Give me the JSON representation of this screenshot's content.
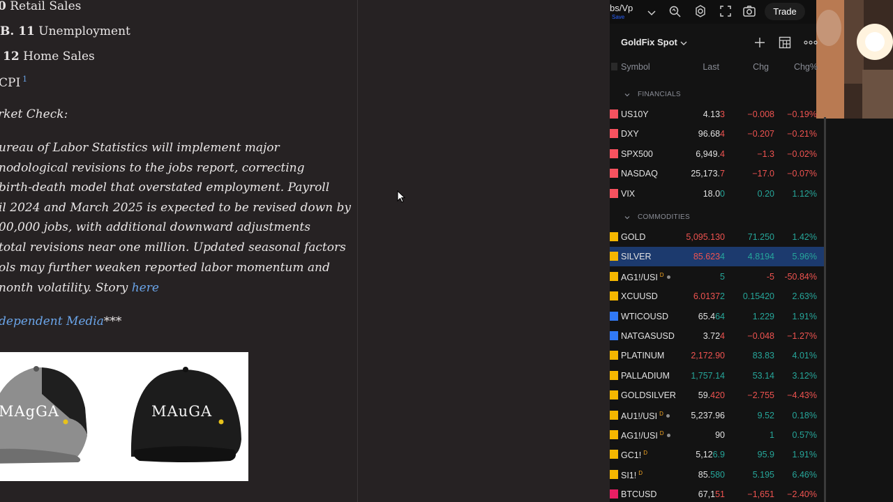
{
  "article": {
    "lines": [
      {
        "bold": "0",
        "rest": " Retail Sales"
      },
      {
        "bold": "B. 11",
        "rest": " Unemployment"
      },
      {
        "bold": "12",
        "rest": " Home Sales"
      },
      {
        "bold": "",
        "rest": "CPI"
      }
    ],
    "cpi_ref": "1",
    "heading": "rket Check:",
    "paragraph": [
      "ureau of Labor Statistics will implement major",
      "nodological revisions to the jobs report, correcting",
      "birth-death model that overstated employment. Payroll",
      "il 2024 and March 2025 is expected to be revised down by",
      "00,000 jobs, with additional downward adjustments",
      "total revisions near one million. Updated seasonal factors",
      "ols may further weaken reported labor momentum and",
      "nonth volatility. Story "
    ],
    "story_link": "here",
    "media_link": "dependent Media",
    "media_suffix": "***",
    "hat_left": "MAgGA",
    "hat_right": "MAuGA"
  },
  "panel": {
    "layout_name": "bs/Vp",
    "layout_save": "Save",
    "trade_label": "Trade",
    "watchlist_title": "GoldFix Spot",
    "columns": {
      "symbol": "Symbol",
      "last": "Last",
      "chg": "Chg",
      "chgp": "Chg%"
    },
    "sections": {
      "financials": "FINANCIALS",
      "commodities": "COMMODITIES"
    },
    "financials": [
      {
        "symbol": "US10Y",
        "last_main": "4.13",
        "last_tail": "3",
        "chg": "−0.008",
        "chgp": "−0.19%",
        "dir": "dn",
        "flag": "#f7525f"
      },
      {
        "symbol": "DXY",
        "last_main": "96.68",
        "last_tail": "4",
        "chg": "−0.207",
        "chgp": "−0.21%",
        "dir": "dn",
        "flag": "#f7525f"
      },
      {
        "symbol": "SPX500",
        "last_main": "6,949.",
        "last_tail": "4",
        "chg": "−1.3",
        "chgp": "−0.02%",
        "dir": "dn",
        "flag": "#f7525f"
      },
      {
        "symbol": "NASDAQ",
        "last_main": "25,173.",
        "last_tail": "7",
        "chg": "−17.0",
        "chgp": "−0.07%",
        "dir": "dn",
        "flag": "#f7525f"
      },
      {
        "symbol": "VIX",
        "last_main": "18.0",
        "last_tail": "0",
        "chg": "0.20",
        "chgp": "1.12%",
        "dir": "up",
        "flag": "#f7525f"
      }
    ],
    "commodities": [
      {
        "symbol": "GOLD",
        "last_main": "5,095.130",
        "last_tail": "",
        "chg": "71.250",
        "chgp": "1.42%",
        "dir": "up",
        "flag": "#f5b700",
        "last_color": "dn"
      },
      {
        "symbol": "SILVER",
        "last_main": "85.623",
        "last_tail": "4",
        "chg": "4.8194",
        "chgp": "5.96%",
        "dir": "up",
        "flag": "#f5b700",
        "last_color": "dn",
        "selected": true
      },
      {
        "symbol": "AG1!/USI",
        "sup": "D",
        "dot": true,
        "last_main": "5",
        "last_tail": "",
        "chg": "-5",
        "chgp": "-50.84%",
        "dir": "dn",
        "flag": "#f5b700",
        "last_color": "up"
      },
      {
        "symbol": "XCUUSD",
        "last_main": "6.0137",
        "last_tail": "2",
        "chg": "0.15420",
        "chgp": "2.63%",
        "dir": "up",
        "flag": "#f5b700",
        "last_color": "dn"
      },
      {
        "symbol": "WTICOUSD",
        "last_main": "65.4",
        "last_tail": "64",
        "chg": "1.229",
        "chgp": "1.91%",
        "dir": "up",
        "flag": "#3179f5"
      },
      {
        "symbol": "NATGASUSD",
        "last_main": "3.72",
        "last_tail": "4",
        "chg": "−0.048",
        "chgp": "−1.27%",
        "dir": "dn",
        "flag": "#3179f5"
      },
      {
        "symbol": "PLATINUM",
        "last_main": "2,172.90",
        "last_tail": "",
        "chg": "83.83",
        "chgp": "4.01%",
        "dir": "up",
        "flag": "#f5b700",
        "last_color": "dn"
      },
      {
        "symbol": "PALLADIUM",
        "last_main": "1,757.14",
        "last_tail": "",
        "chg": "53.14",
        "chgp": "3.12%",
        "dir": "up",
        "flag": "#f5b700",
        "last_color": "up"
      },
      {
        "symbol": "GOLDSILVER",
        "last_main": "59.",
        "last_tail": "420",
        "chg": "−2.755",
        "chgp": "−4.43%",
        "dir": "dn",
        "flag": "#f5b700"
      },
      {
        "symbol": "AU1!/USI",
        "sup": "D",
        "dot": true,
        "last_main": "5,237.96",
        "last_tail": "",
        "chg": "9.52",
        "chgp": "0.18%",
        "dir": "up",
        "flag": "#f5b700"
      },
      {
        "symbol": "AG1!/USI",
        "sup": "D",
        "dot": true,
        "last_main": "90",
        "last_tail": "",
        "chg": "1",
        "chgp": "0.57%",
        "dir": "up",
        "flag": "#f5b700"
      },
      {
        "symbol": "GC1!",
        "sup": "D",
        "last_main": "5,12",
        "last_tail": "6.9",
        "chg": "95.9",
        "chgp": "1.91%",
        "dir": "up",
        "flag": "#f5b700"
      },
      {
        "symbol": "SI1!",
        "sup": "D",
        "last_main": "85.",
        "last_tail": "580",
        "chg": "5.195",
        "chgp": "6.46%",
        "dir": "up",
        "flag": "#f5b700"
      },
      {
        "symbol": "BTCUSD",
        "last_main": "67,1",
        "last_tail": "51",
        "chg": "−1,651",
        "chgp": "−2.40%",
        "dir": "dn",
        "flag": "#e91e63"
      }
    ]
  }
}
